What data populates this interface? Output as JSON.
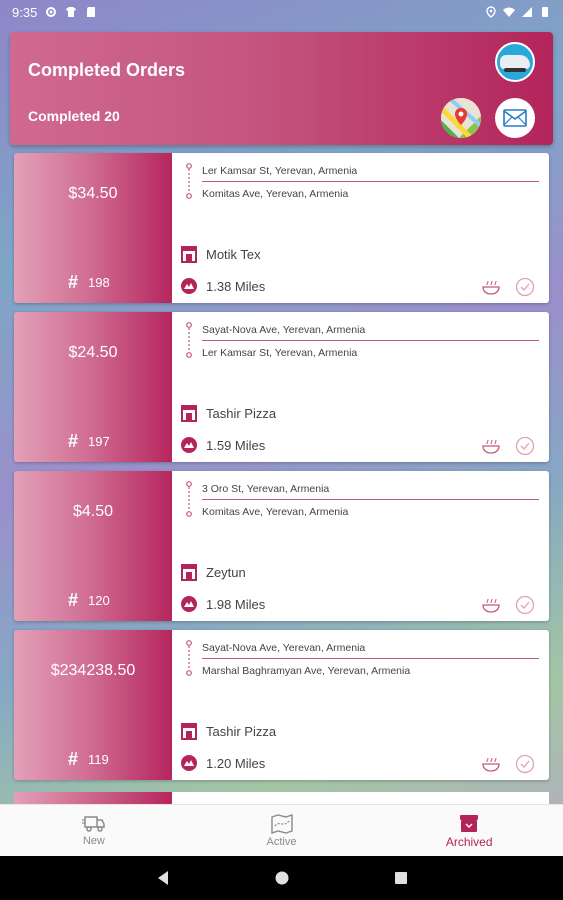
{
  "status_bar": {
    "time": "9:35"
  },
  "header": {
    "title": "Completed Orders",
    "completed_label": "Completed 20"
  },
  "orders": [
    {
      "price": "$34.50",
      "number": "198",
      "pickup": "Ler Kamsar St, Yerevan, Armenia",
      "dropoff": "Komitas Ave, Yerevan, Armenia",
      "shop": "Motik Tex",
      "distance": "1.38 Miles"
    },
    {
      "price": "$24.50",
      "number": "197",
      "pickup": "Sayat-Nova Ave, Yerevan, Armenia",
      "dropoff": "Ler Kamsar St, Yerevan, Armenia",
      "shop": "Tashir Pizza",
      "distance": "1.59 Miles"
    },
    {
      "price": "$4.50",
      "number": "120",
      "pickup": "3 Oro St, Yerevan, Armenia",
      "dropoff": "Komitas Ave, Yerevan, Armenia",
      "shop": "Zeytun",
      "distance": "1.98 Miles"
    },
    {
      "price": "$234238.50",
      "number": "119",
      "pickup": "Sayat-Nova Ave, Yerevan, Armenia",
      "dropoff": "Marshal Baghramyan Ave, Yerevan, Armenia",
      "shop": "Tashir Pizza",
      "distance": "1.20 Miles"
    }
  ],
  "bottom_nav": {
    "new_label": "New",
    "active_label": "Active",
    "archived_label": "Archived"
  },
  "colors": {
    "accent": "#b3245a",
    "accent_light": "#e3a0b7"
  },
  "icons": {
    "hash": "#"
  }
}
